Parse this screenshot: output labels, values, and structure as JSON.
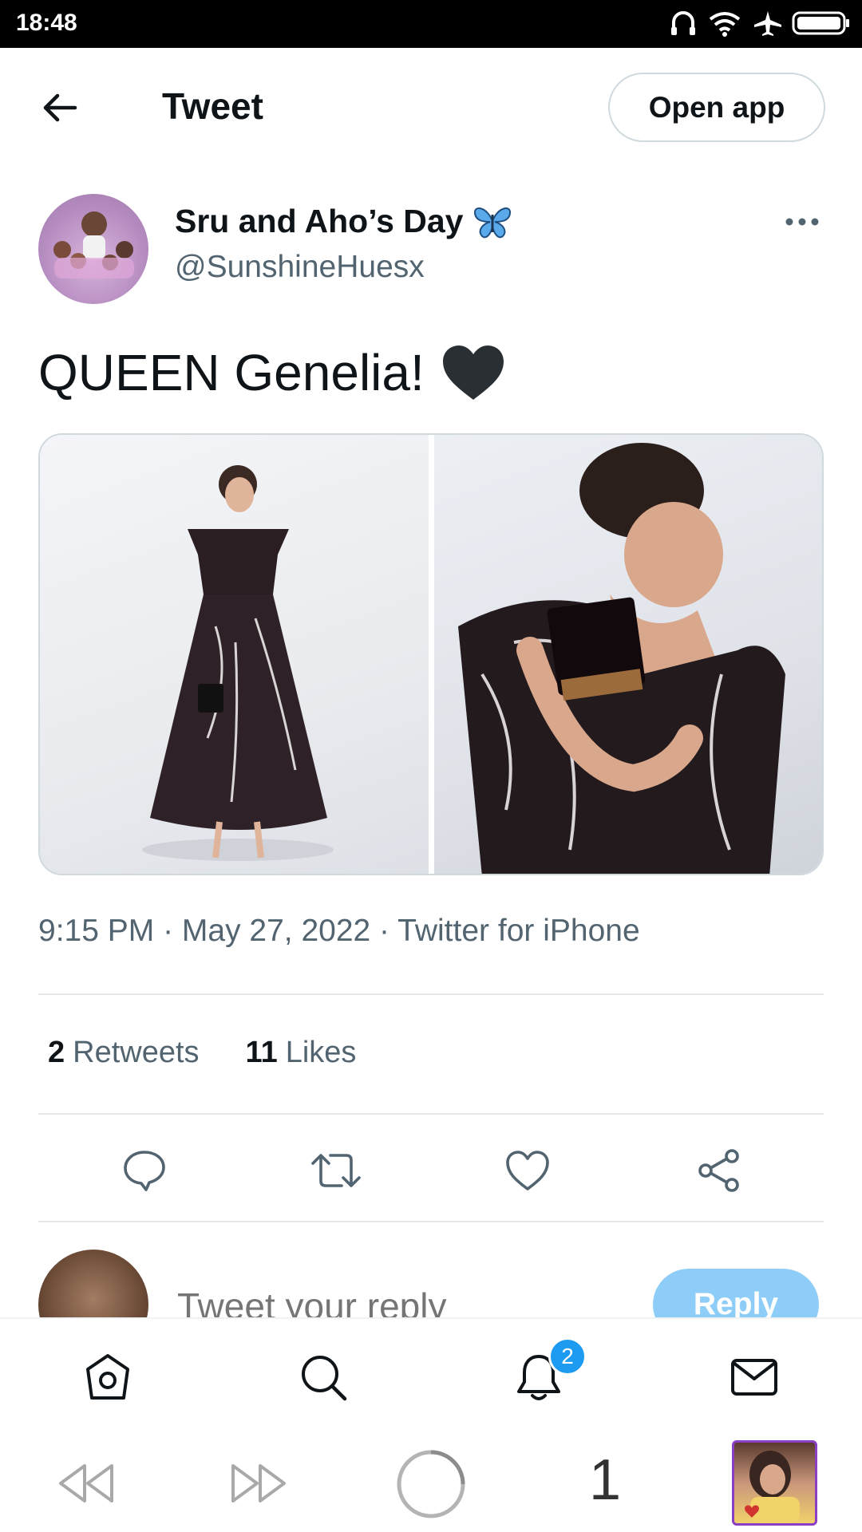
{
  "status_bar": {
    "time": "18:48"
  },
  "header": {
    "title": "Tweet",
    "open_app_label": "Open app"
  },
  "author": {
    "name": "Sru and Aho’s Day",
    "handle": "@SunshineHuesx"
  },
  "tweet": {
    "text": "QUEEN Genelia!",
    "meta": "9:15 PM · May 27, 2022 · Twitter for iPhone",
    "retweet_count": "2",
    "retweets_label": "Retweets",
    "like_count": "11",
    "likes_label": "Likes"
  },
  "reply": {
    "placeholder": "Tweet your reply",
    "button_label": "Reply"
  },
  "bottom_nav": {
    "items": [
      "home-icon",
      "search-icon",
      "notifications-icon",
      "messages-icon"
    ],
    "notification_count": "2"
  },
  "browser_bar": {
    "tab_count": "1"
  },
  "colors": {
    "accent": "#1d9bf0",
    "reply_button": "#8ecdf8",
    "muted_text": "#536471",
    "divider": "#e6e9eb"
  }
}
